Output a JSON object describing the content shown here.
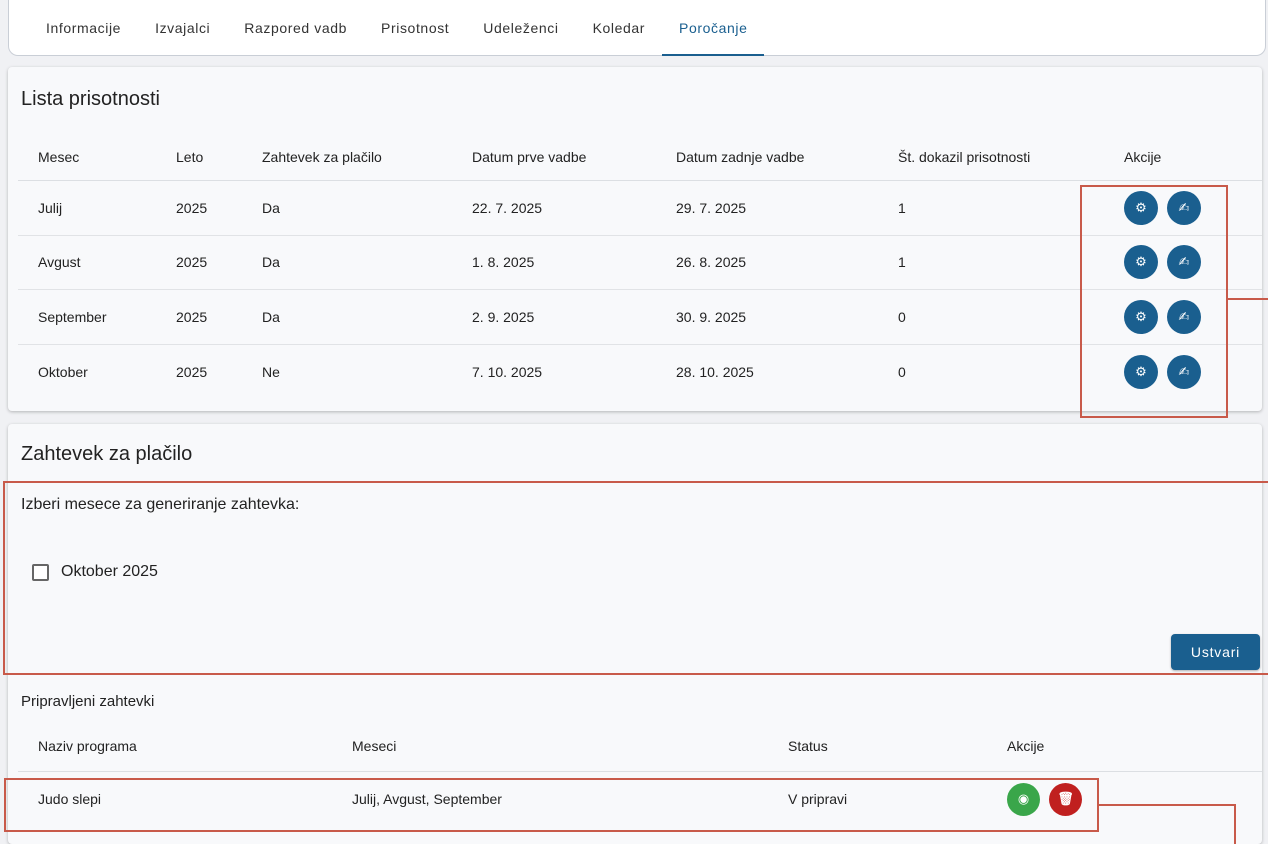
{
  "tabs": [
    {
      "label": "Informacije"
    },
    {
      "label": "Izvajalci"
    },
    {
      "label": "Razpored vadb"
    },
    {
      "label": "Prisotnost"
    },
    {
      "label": "Udeleženci"
    },
    {
      "label": "Koledar"
    },
    {
      "label": "Poročanje",
      "active": true
    }
  ],
  "attendance": {
    "title": "Lista prisotnosti",
    "columns": [
      "Mesec",
      "Leto",
      "Zahtevek za plačilo",
      "Datum prve vadbe",
      "Datum zadnje vadbe",
      "Št. dokazil prisotnosti",
      "Akcije"
    ],
    "rows": [
      {
        "month": "Julij",
        "year": "2025",
        "payment": "Da",
        "first": "22. 7. 2025",
        "last": "29. 7. 2025",
        "proofs": "1"
      },
      {
        "month": "Avgust",
        "year": "2025",
        "payment": "Da",
        "first": "1. 8. 2025",
        "last": "26. 8. 2025",
        "proofs": "1"
      },
      {
        "month": "September",
        "year": "2025",
        "payment": "Da",
        "first": "2. 9. 2025",
        "last": "30. 9. 2025",
        "proofs": "0"
      },
      {
        "month": "Oktober",
        "year": "2025",
        "payment": "Ne",
        "first": "7. 10. 2025",
        "last": "28. 10. 2025",
        "proofs": "0"
      }
    ],
    "action_icons": [
      "settings-icon",
      "signature-icon"
    ]
  },
  "payment_request": {
    "title": "Zahtevek za plačilo",
    "select_label": "Izberi mesece za generiranje zahtevka:",
    "options": [
      {
        "label": "Oktober 2025",
        "checked": false
      }
    ],
    "create_button": "Ustvari",
    "prepared_title": "Pripravljeni zahtevki",
    "columns": [
      "Naziv programa",
      "Meseci",
      "Status",
      "Akcije"
    ],
    "rows": [
      {
        "program": "Judo slepi",
        "months": "Julij, Avgust, September",
        "status": "V pripravi"
      }
    ],
    "row_action_icons": [
      "radio-icon",
      "trash-icon"
    ]
  },
  "colors": {
    "primary": "#1a5f8f",
    "success": "#3aa64a",
    "danger": "#c0201f",
    "annotation": "#c85a4a"
  }
}
